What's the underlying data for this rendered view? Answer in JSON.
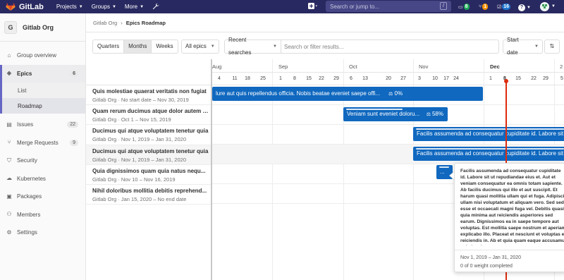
{
  "brand": {
    "name": "GitLab",
    "logo_icon": "gitlab-logo-icon"
  },
  "topnav": {
    "menus": [
      "Projects",
      "Groups",
      "More"
    ],
    "search_placeholder": "Search or jump to...",
    "search_shortcut": "/",
    "counters": [
      {
        "icon": "issues-icon",
        "count": "8",
        "color": "#1aaa55"
      },
      {
        "icon": "merge-request-icon",
        "count": "1",
        "color": "#fc9403"
      },
      {
        "icon": "todo-icon",
        "count": "16",
        "color": "#1f78d1"
      }
    ],
    "help": "?"
  },
  "sidebar": {
    "group_initial": "G",
    "group_name": "Gitlab Org",
    "items": [
      {
        "label": "Group overview",
        "icon": "home-icon"
      },
      {
        "label": "Epics",
        "icon": "epic-icon",
        "count": "6"
      },
      {
        "label": "Issues",
        "icon": "issues-icon",
        "count": "22"
      },
      {
        "label": "Merge Requests",
        "icon": "merge-request-icon",
        "count": "9"
      },
      {
        "label": "Security",
        "icon": "shield-icon"
      },
      {
        "label": "Kubernetes",
        "icon": "cloud-icon"
      },
      {
        "label": "Packages",
        "icon": "package-icon"
      },
      {
        "label": "Members",
        "icon": "users-icon"
      },
      {
        "label": "Settings",
        "icon": "settings-icon"
      }
    ],
    "epics_sub": [
      "List",
      "Roadmap"
    ]
  },
  "breadcrumb": {
    "group": "Gitlab Org",
    "current": "Epics Roadmap"
  },
  "filters": {
    "presets": [
      "Quarters",
      "Months",
      "Weeks"
    ],
    "active_preset": "Months",
    "epics_state": "All epics",
    "recent": "Recent searches",
    "filter_placeholder": "Search or filter results...",
    "sort": "Start date"
  },
  "timeline": {
    "months": [
      "Aug",
      "Sep",
      "Oct",
      "Nov",
      "Dec",
      "2"
    ],
    "current_month": "Dec",
    "days": [
      "4",
      "11",
      "18",
      "25",
      "1",
      "8",
      "15",
      "22",
      "29",
      "6",
      "13",
      "20",
      "27",
      "3",
      "10",
      "17",
      "24",
      "1",
      "8",
      "15",
      "22",
      "29",
      "5"
    ],
    "today": "8"
  },
  "epics": [
    {
      "title": "Quis molestiae quaerat veritatis non fugiat",
      "meta": "Gitlab Org · No start date – Nov 30, 2019",
      "bar_text": "lure aut quis repellendus officia. Nobis beatae eveniet saepe offi...",
      "progress": "0%",
      "progress_fraction": 0
    },
    {
      "title": "Quam rerum ducimus atque dolor autem sunt",
      "meta": "Gitlab Org · Oct 1 – Nov 15, 2019",
      "bar_text": "Veniam sunt eveniet doloru...",
      "progress": "58%",
      "progress_fraction": 0.58
    },
    {
      "title": "Ducimus qui atque voluptatem tenetur quia",
      "meta": "Gitlab Org · Nov 1, 2019 – Jan 31, 2020",
      "bar_text": "Facilis assumenda ad consequatur cupiditate id. Labore sit",
      "progress": "",
      "progress_fraction": 0
    },
    {
      "title": "Ducimus qui atque voluptatem tenetur quia",
      "meta": "Gitlab Org · Nov 1, 2019 – Jan 31, 2020",
      "bar_text": "Facilis assumenda ad consequatur cupiditate id. Labore sit",
      "progress": "",
      "progress_fraction": 0
    },
    {
      "title": "Quia dignissimos quam quia natus nequ...",
      "meta": "Gitlab Org · Nov 10 – Nov 16, 2019",
      "bar_text": "...",
      "progress": "",
      "progress_fraction": 0
    },
    {
      "title": "Nihil doloribus mollitia debitis reprehend...",
      "meta": "Gitlab Org · Jan 15, 2020 – No end date",
      "bar_text": "",
      "progress": "",
      "progress_fraction": 0
    }
  ],
  "popover": {
    "title": "Facilis assumenda ad consequatur cupiditate id. Labore sit ut repudiandae eius et. Aut et veniam consequatur ea omnis totam sapiente. Ab facilis ducimus qui illo et aut suscipit. Et harum quasi mollitia ullam qui et fuga. Adipisci ullam nisi voluptatum et aliquam vero. Sed sed esse et occaecati magni fuga vel. Debitis quasi quia minima aut reiciendis asperiores sed earum. Dignissimos ea in saepe tempore aut voluptas. Est mollitia saepe nostrum et aperiam explicabo illo. Placeat et nesciunt et voluptas ea reiciendis in. Ab et quia quam eaque accusamus animi sed.",
    "dates": "Nov 1, 2019 – Jan 31, 2020",
    "weight": "0 of 0 weight completed"
  }
}
